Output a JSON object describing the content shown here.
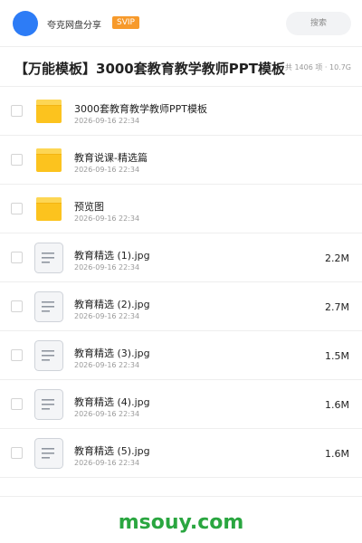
{
  "header": {
    "share_name": "夸克网盘分享",
    "badge": "SVIP",
    "search_label": "搜索"
  },
  "folder": {
    "title": "【万能模板】3000套教育教学教师PPT模板",
    "summary": "共 1406 项 · 10.7G"
  },
  "files": [
    {
      "name": "3000套教育教学教师PPT模板",
      "date": "2026-09-16 22:34",
      "size": "",
      "kind": "folder"
    },
    {
      "name": "教育说课-精选篇",
      "date": "2026-09-16 22:34",
      "size": "",
      "kind": "folder"
    },
    {
      "name": "预览图",
      "date": "2026-09-16 22:34",
      "size": "",
      "kind": "folder"
    },
    {
      "name": "教育精选 (1).jpg",
      "date": "2026-09-16 22:34",
      "size": "2.2M",
      "kind": "file"
    },
    {
      "name": "教育精选 (2).jpg",
      "date": "2026-09-16 22:34",
      "size": "2.7M",
      "kind": "file"
    },
    {
      "name": "教育精选 (3).jpg",
      "date": "2026-09-16 22:34",
      "size": "1.5M",
      "kind": "file"
    },
    {
      "name": "教育精选 (4).jpg",
      "date": "2026-09-16 22:34",
      "size": "1.6M",
      "kind": "file"
    },
    {
      "name": "教育精选 (5).jpg",
      "date": "2026-09-16 22:34",
      "size": "1.6M",
      "kind": "file"
    }
  ],
  "watermark": "msouy.com",
  "colors": {
    "avatar": "#2d7cf6",
    "badge": "#f79a2b",
    "folder": "#fcc31e",
    "watermark": "#2aa640"
  },
  "icons": {
    "folder": "folder-icon",
    "file": "document-icon"
  }
}
